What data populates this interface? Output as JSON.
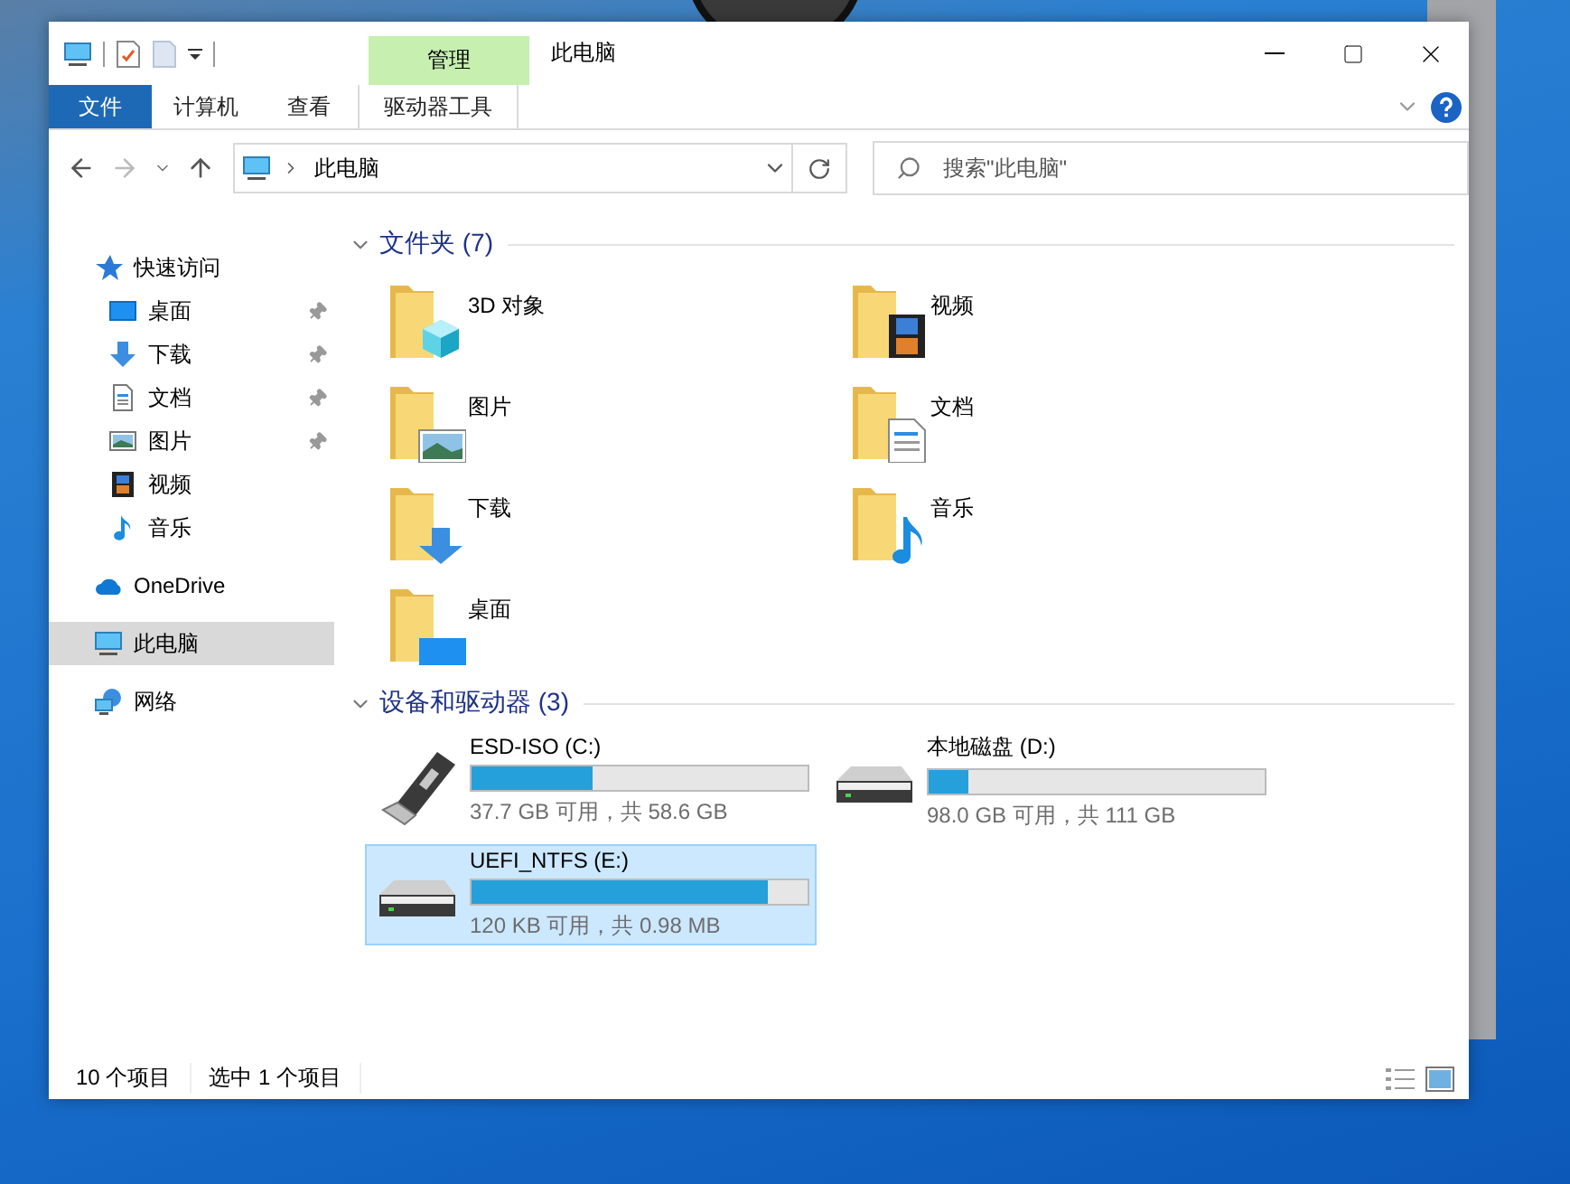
{
  "window": {
    "title": "此电脑"
  },
  "ribbon": {
    "context_label": "管理",
    "tabs": [
      {
        "label": "文件",
        "kind": "file"
      },
      {
        "label": "计算机",
        "kind": "plain"
      },
      {
        "label": "查看",
        "kind": "plain"
      },
      {
        "label": "驱动器工具",
        "kind": "context"
      }
    ]
  },
  "address": {
    "path": "此电脑"
  },
  "search": {
    "placeholder": "搜索\"此电脑\""
  },
  "sidebar": {
    "items": [
      {
        "label": "快速访问",
        "kind": "quick",
        "selected": false,
        "children": [
          {
            "label": "桌面",
            "kind": "desktop",
            "pinned": true
          },
          {
            "label": "下载",
            "kind": "downloads",
            "pinned": true
          },
          {
            "label": "文档",
            "kind": "documents",
            "pinned": true
          },
          {
            "label": "图片",
            "kind": "pictures",
            "pinned": true
          },
          {
            "label": "视频",
            "kind": "videos",
            "pinned": false
          },
          {
            "label": "音乐",
            "kind": "music",
            "pinned": false
          }
        ]
      },
      {
        "label": "OneDrive",
        "kind": "onedrive",
        "selected": false
      },
      {
        "label": "此电脑",
        "kind": "pc",
        "selected": true
      },
      {
        "label": "网络",
        "kind": "network",
        "selected": false
      }
    ]
  },
  "sections": [
    {
      "title": "文件夹 (7)",
      "expanded": true,
      "kind": "folders",
      "items": [
        {
          "name": "3D 对象",
          "kind": "objects"
        },
        {
          "name": "视频",
          "kind": "videos"
        },
        {
          "name": "图片",
          "kind": "pictures"
        },
        {
          "name": "文档",
          "kind": "documents"
        },
        {
          "name": "下载",
          "kind": "downloads"
        },
        {
          "name": "音乐",
          "kind": "music"
        },
        {
          "name": "桌面",
          "kind": "desktop"
        }
      ]
    },
    {
      "title": "设备和驱动器 (3)",
      "expanded": true,
      "kind": "drives",
      "items": [
        {
          "name": "ESD-ISO (C:)",
          "kind": "usb",
          "level": 0.36,
          "info": "37.7 GB 可用，共 58.6 GB",
          "selected": false
        },
        {
          "name": "本地磁盘 (D:)",
          "kind": "hdd",
          "level": 0.12,
          "info": "98.0 GB 可用，共 111 GB",
          "selected": false
        },
        {
          "name": "UEFI_NTFS (E:)",
          "kind": "hdd",
          "level": 0.88,
          "info": "120 KB 可用，共 0.98 MB",
          "selected": true
        }
      ]
    }
  ],
  "status_bar": {
    "count": "10 个项目",
    "selection": "选中 1 个项目"
  }
}
